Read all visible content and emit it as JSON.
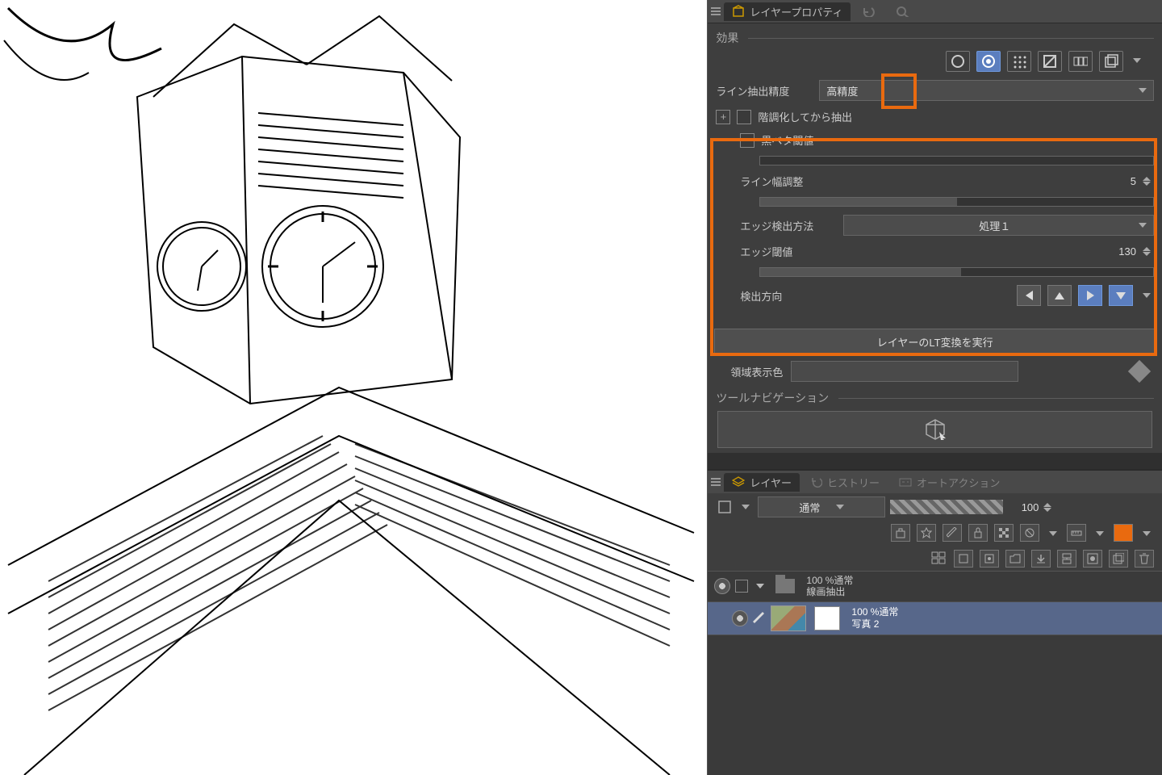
{
  "layer_property": {
    "tab_title": "レイヤープロパティ",
    "effect_label": "効果",
    "line_precision_label": "ライン抽出精度",
    "line_precision_value": "高精度",
    "posterize_label": "階調化してから抽出",
    "black_threshold_label": "黒ベタ閾値",
    "line_width_label": "ライン幅調整",
    "line_width_value": "5",
    "edge_method_label": "エッジ検出方法",
    "edge_method_value": "処理１",
    "edge_threshold_label": "エッジ閾値",
    "edge_threshold_value": "130",
    "detect_dir_label": "検出方向",
    "lt_button": "レイヤーのLT変換を実行",
    "area_color_label": "領域表示色",
    "tool_nav_label": "ツールナビゲーション"
  },
  "layer_panel": {
    "tab_layer": "レイヤー",
    "tab_history": "ヒストリー",
    "tab_auto": "オートアクション",
    "blend_mode": "通常",
    "opacity": "100",
    "folder": {
      "opacity_text": "100 %通常",
      "name": "線画抽出"
    },
    "layer": {
      "opacity_text": "100 %通常",
      "name": "写真 2"
    }
  }
}
